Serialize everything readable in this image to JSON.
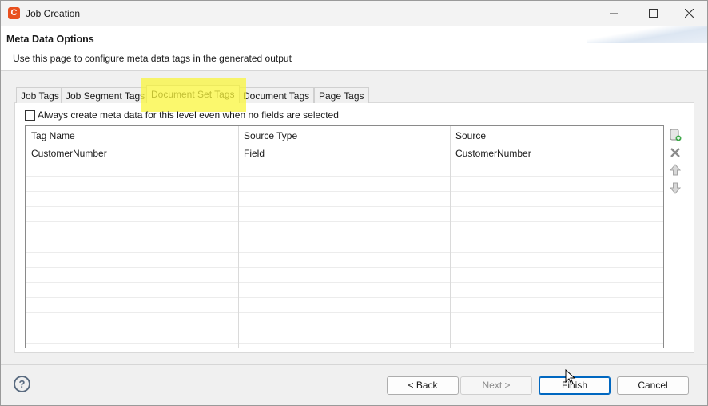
{
  "window": {
    "title": "Job Creation",
    "app_icon_letter": "C",
    "controls": [
      "minimize-icon",
      "maximize-icon",
      "close-icon"
    ]
  },
  "header": {
    "title": "Meta Data Options",
    "description": "Use this page to configure meta data tags in the generated output"
  },
  "tabs": [
    {
      "label": "Job Tags"
    },
    {
      "label": "Job Segment Tags"
    },
    {
      "label": "Document Set Tags"
    },
    {
      "label": "Document Tags"
    },
    {
      "label": "Page Tags"
    }
  ],
  "active_tab": "Document Set Tags",
  "options": {
    "always_create_label": "Always create meta data for this level even when no fields are selected",
    "always_create_checked": false
  },
  "table": {
    "columns": [
      "Tag Name",
      "Source Type",
      "Source"
    ],
    "rows": [
      {
        "tag_name": "CustomerNumber",
        "source_type": "Field",
        "source": "CustomerNumber"
      }
    ]
  },
  "side_tools": [
    "add-icon",
    "delete-icon",
    "move-up-icon",
    "move-down-icon"
  ],
  "footer": {
    "help": "?",
    "back": "< Back",
    "next": "Next >",
    "finish": "Finish",
    "cancel": "Cancel"
  },
  "colors": {
    "highlight": "#faf53c",
    "accent": "#0067c0",
    "app_icon": "#e8501e"
  }
}
